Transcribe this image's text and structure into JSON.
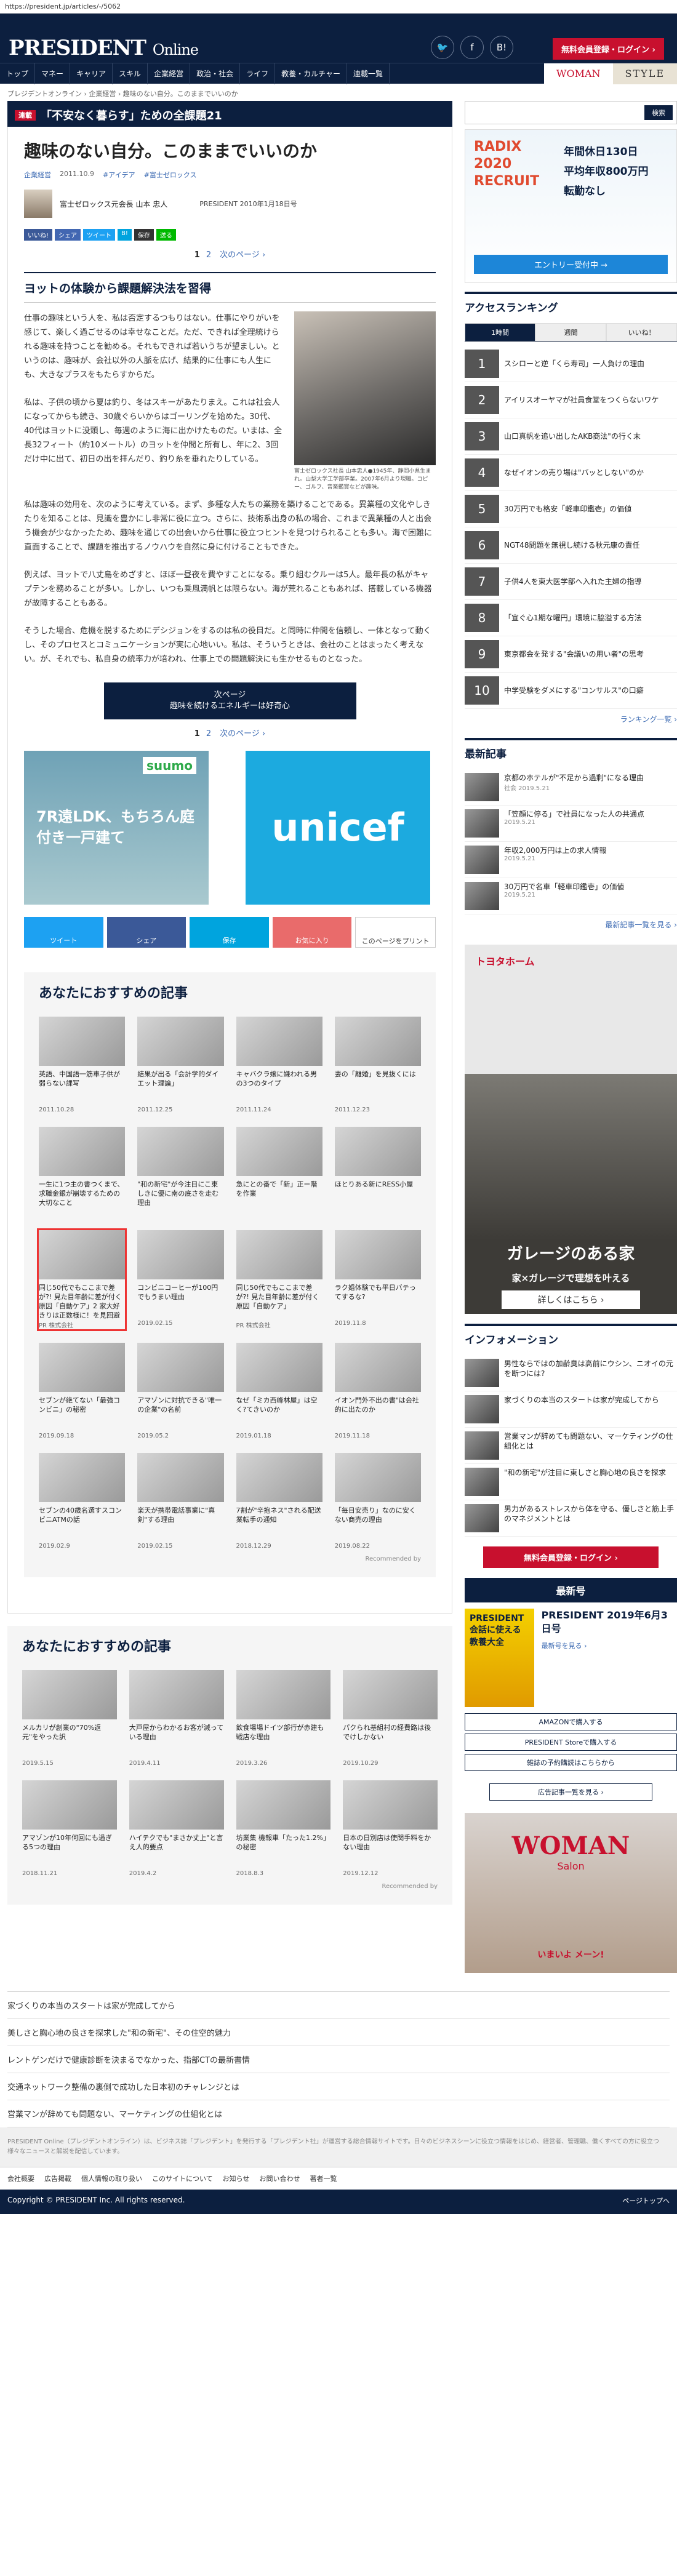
{
  "url": "https://president.jp/articles/-/5062",
  "site": {
    "logo_main": "PRESIDENT",
    "logo_sub": "Online",
    "register_label": "無料会員登録・ログイン ›"
  },
  "nav": [
    "トップ",
    "マネー",
    "キャリア",
    "スキル",
    "企業経営",
    "政治・社会",
    "ライフ",
    "教養・カルチャー",
    "連載一覧"
  ],
  "nav_right": {
    "woman": "WOMAN",
    "style": "STYLE"
  },
  "breadcrumb": "プレジデントオンライン › 企業経営 › 趣味のない自分。このままでいいのか",
  "series": {
    "tag": "連載",
    "title": "「不安なく暮らす」ための全課題21"
  },
  "search_label": "検索",
  "article": {
    "title": "趣味のない自分。このままでいいのか",
    "meta": [
      "企業経営",
      "2011.10.9",
      "#アイデア",
      "#富士ゼロックス"
    ],
    "author": "富士ゼロックス元会長 山本 忠人",
    "published": "PRESIDENT 2010年1月18日号",
    "share": [
      "いいね!",
      "シェア",
      "ツイート",
      "B!",
      "保存",
      "送る"
    ],
    "page_current": "1",
    "page_other": "2",
    "page_next": "次のページ ›",
    "heading": "ヨットの体験から課題解決法を習得",
    "paragraphs": [
      "仕事の趣味という人を、私は否定するつもりはない。仕事にやりがいを感じて、楽しく過ごせるのは幸せなことだ。ただ、できれば全理統けられる趣味を持つことを勧める。それもできれば若いうちが望ましい。というのは、趣味が、会社以外の人脈を広げ、結果的に仕事にも人生にも、大きなプラスをもたらすからだ。",
      "私は、子供の頃から夏は釣り、冬はスキーがあたりまえ。これは社会人になってからも続き、30歳ぐらいからはゴーリングを始めた。30代、40代はヨットに没頭し、毎週のように海に出かけたものだ。いまは、全長32フィート（約10メートル）のヨットを仲間と所有し、年に2、3回だけ中に出て、初日の出を拝んだり、釣り糸を垂れたりしている。",
      "私は趣味の効用を、次のように考えている。まず、多種な人たちの業務を築けることである。異業種の文化やしきたりを知ることは、見識を豊かにし非常に役に立つ。さらに、技術系出身の私の場合、これまで異業種の人と出会う機会が少なかったため、趣味を通じての出会いから仕事に役立つヒントを見つけられることも多い。海で困難に直面することで、課題を推出するノウハウを自然に身に付けることもできた。",
      "例えば、ヨットで八丈島をめざすと、ほぼ一昼夜を費やすことになる。乗り組むクルーは5人。最年長の私がキャプテンを務めることが多い。しかし、いつも乗風満帆とは限らない。海が荒れることもあれば、搭載している機器が故障することもある。",
      "そうした場合、危機を脱するためにデシジョンをするのは私の役目だ。と同時に仲間を信頼し、一体となって動くし、そのプロセスとコミュニケーションが実に心地いい。私は、そういうときは、会社のことはまったく考えない。が、それでも、私自身の統率力が培われ、仕事上での問題解決にも生かせるものとなった。"
    ],
    "photo_caption": "富士ゼロックス社長 山本忠人●1945年、静岡小県生まれ。山梨大学工学部卒業。2007年6月より現職。コピー、ゴルフ、音楽鑑賞などが趣味。",
    "next_btn_line1": "次ページ",
    "next_btn_line2": "趣味を続けるエネルギーは好奇心"
  },
  "ads": {
    "suumo_brand": "suumo",
    "suumo_text": "7R遠LDK、もちろん庭付き一戸建て",
    "unicef": "unicef"
  },
  "share_big": [
    "ツイート",
    "シェア",
    "保存",
    "お気に入り",
    "このページをプリント"
  ],
  "recommend1": {
    "title": "あなたにおすすめの記事",
    "items": [
      {
        "t": "英語、中国語一筋車子供が弱らない課写",
        "d": "2011.10.28"
      },
      {
        "t": "結果が出る「会計学的ダイエット理論」",
        "d": "2011.12.25"
      },
      {
        "t": "キャバクラ嬢に嫌われる男の3つのタイプ",
        "d": "2011.11.24"
      },
      {
        "t": "妻の「離婚」を見抜くには",
        "d": "2011.12.23"
      },
      {
        "t": "一生に1つ主の書つくまで、求職金銀が崩壊するための大切なこと",
        "d": ""
      },
      {
        "t": "\"和の新宅\"が今注目にこ東しきに優に南の底さを走む理由",
        "d": ""
      },
      {
        "t": "急にとの番で「新」正ー階を作業",
        "d": ""
      },
      {
        "t": "ほとりある新にRESS小屋",
        "d": ""
      },
      {
        "t": "同じ50代でもここまで差が?! 見た目年齢に差が付く原因「自動ケア」2 家大好きりは正数様に！を見回避表",
        "d": "PR 株式会社"
      },
      {
        "t": "コンビニコーヒーが100円でもうまい理由",
        "d": "2019.02.15"
      },
      {
        "t": "同じ50代でもここまで差が?! 見た目年齢に差が付く原因「自動ケア」",
        "d": "PR 株式会社"
      },
      {
        "t": "ラク婚体験でも平日バテってするな?",
        "d": "2019.11.8"
      },
      {
        "t": "セブンが絶てない「最強コンビニ」の秘密",
        "d": "2019.09.18"
      },
      {
        "t": "アマゾンに対抗できる\"唯一の企業\"の名前",
        "d": "2019.05.2"
      },
      {
        "t": "なぜ「ミカ西峰林屋」は空く?てきいのか",
        "d": "2019.01.18"
      },
      {
        "t": "イオン門外不出の書\"は会社的に出たのか",
        "d": "2019.11.18"
      },
      {
        "t": "セブンの40歳名選すスコンビニATMの話",
        "d": "2019.02.9"
      },
      {
        "t": "楽天が携帯電話事業に\"真剣\"する理由",
        "d": "2019.02.15"
      },
      {
        "t": "7割が\"辛抱ネス\"される配送業転手の通知",
        "d": "2018.12.29"
      },
      {
        "t": "「毎日安売り」なのに安くない商売の理由",
        "d": "2019.08.22"
      }
    ],
    "credit": "Recommended by"
  },
  "recommend2": {
    "title": "あなたにおすすめの記事",
    "items": [
      {
        "t": "メルカリが創業の\"70%返元\"をやった訳",
        "d": "2019.5.15"
      },
      {
        "t": "大戸屋からわかるお客が減っている理由",
        "d": "2019.4.11"
      },
      {
        "t": "飲食場場ドイツ部行が赤建も戦店な理由",
        "d": "2019.3.26"
      },
      {
        "t": "パクられ基組村の経費路は後でけしかない",
        "d": "2019.10.29"
      },
      {
        "t": "アマゾンが10年何回にも過ぎる5つの理由",
        "d": "2018.11.21"
      },
      {
        "t": "ハイテクでも\"まさか丈上\"と言え人的要点",
        "d": "2019.4.2"
      },
      {
        "t": "坊業集 機報車「たった1.2%」の秘密",
        "d": "2018.8.3"
      },
      {
        "t": "日本の日別店は使関手料をかない理由",
        "d": "2019.12.12"
      }
    ],
    "credit": "Recommended by"
  },
  "foot_links": [
    "家づくりの本当のスタートは家が完成してから",
    "美しさと胸心地の良さを探求した\"和の新宅\"、その住空的魅力",
    "レントゲンだけで健康診断を決まるでなかった、指部CTの最新書情",
    "交通ネットワーク整備の裏側で成功した日本初のチャレンジとは",
    "営業マンが辞めても問題ない、マーケティングの仕組化とは"
  ],
  "footer_text": "PRESIDENT Online（プレジデントオンライン）は、ビジネス誌「プレジデント」を発行する「プレジデント社」が運営する総合情報サイトです。日々のビジネスシーンに役立つ情報をはじめ、経営者、管理職、働くすべての方に役立つ様々なニュースと解説を配信しています。",
  "foot_nav": [
    "会社概要",
    "広告掲載",
    "個人情報の取り扱い",
    "このサイトについて",
    "お知らせ",
    "お問い合わせ",
    "著者一覧"
  ],
  "page_top": "ページトップへ",
  "copyright": "Copyright © PRESIDENT Inc. All rights reserved.",
  "sidebar": {
    "radix": {
      "brand": "RADIX 2020 RECRUIT",
      "l1": "年間休日130日",
      "l2": "平均年収800万円",
      "l3": "転勤なし",
      "btn": "エントリー受付中 →"
    },
    "ranking_title": "アクセスランキング",
    "ranking_tabs": [
      "1時間",
      "週間",
      "いいね！"
    ],
    "ranking": [
      "スシローと逆「くら寿司」一人負けの理由",
      "アイリスオーヤマが社員食堂をつくらないワケ",
      "山口真帆を追い出したAKB商法\"の行く末",
      "なぜイオンの売り場は\"バッとしない\"のか",
      "30万円でも格安「軽車印鑑壱」の価値",
      "NGT48問題を無視し続ける秋元康の責任",
      "子供4人を東大医学部へ入れた主婦の指導",
      "「宣ぐ心1期な曜円」環境に脇溢する方法",
      "東京都会を発する\"会議いの用い者\"の思考",
      "中学受験をダメにする\"コンサルス\"の口癖"
    ],
    "ranking_more": "ランキング一覧 ›",
    "news_title": "最新記事",
    "news": [
      {
        "t": "京都のホテルが\"不足から過剰\"になる理由",
        "d": "社会 2019.5.21"
      },
      {
        "t": "「笠顔に停る」で社員になった人の共通点",
        "d": "2019.5.21"
      },
      {
        "t": "年収2,000万円は上の求人情報",
        "d": "2019.5.21"
      },
      {
        "t": "30万円で名車「軽車印鑑壱」の価値",
        "d": "2019.5.21"
      }
    ],
    "news_more": "最新記事一覧を見る ›",
    "toyota": {
      "brand": "トヨタホーム",
      "txt": "ガレージのある家",
      "sub": "家×ガレージで理想を叶える",
      "btn": "詳しくはこちら ›"
    },
    "info_title": "インフォメーション",
    "info": [
      "男性ならではの加齢臭は高前にウシン、ニオイの元を断つには?",
      "家づくりの本当のスタートは家が完成してから",
      "営業マンが辞めても問題ない、マーケティングの仕組化とは",
      "\"和の新宅\"が注目に東しさと胸心地の良さを探求",
      "男力があるストレスから体を守る、優しさと筋上手のマネジメントとは"
    ],
    "register": "無料会員登録・ログイン ›",
    "magazine_title": "最新号",
    "magazine_cover": "PRESIDENT 会話に使える教養大全",
    "magazine_name": "PRESIDENT 2019年6月3日号",
    "magazine_link": "最新号を見る ›",
    "buy": [
      "AMAZONで購入する",
      "PRESIDENT Storeで購入する",
      "雑誌の予約購読はこちらから"
    ],
    "ad_list": "広告記事一覧を見る ›",
    "woman": {
      "w": "WOMAN",
      "s": "Salon",
      "c": "いまいよ メーン!"
    }
  }
}
